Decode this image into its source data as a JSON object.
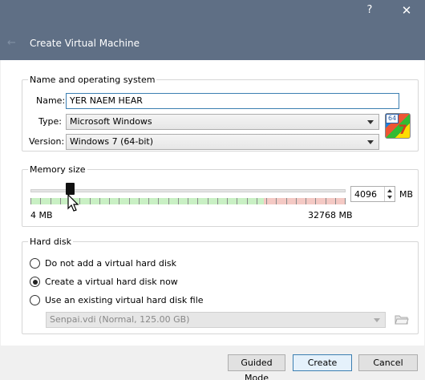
{
  "window": {
    "title": "Create Virtual Machine",
    "help_glyph": "?",
    "close_glyph": "✕",
    "back_glyph": "←"
  },
  "name_os": {
    "legend": "Name and operating system",
    "name_label": "Name:",
    "name_value": "YER NAEM HEAR",
    "type_label": "Type:",
    "type_value": "Microsoft Windows",
    "version_label": "Version:",
    "version_value": "Windows 7 (64-bit)",
    "os_icon": "windows-7-64bit-icon",
    "os_icon_badge": "64",
    "os_icon_version": "7"
  },
  "memory": {
    "legend": "Memory size",
    "min_label": "4 MB",
    "max_label": "32768 MB",
    "value": "4096",
    "unit": "MB",
    "slider_fraction": 0.125,
    "green_fraction": 0.74
  },
  "hard_disk": {
    "legend": "Hard disk",
    "options": [
      {
        "label": "Do not add a virtual hard disk",
        "checked": false
      },
      {
        "label": "Create a virtual hard disk now",
        "checked": true
      },
      {
        "label": "Use an existing virtual hard disk file",
        "checked": false
      }
    ],
    "existing_file": "Senpai.vdi (Normal, 125.00 GB)"
  },
  "buttons": {
    "guided": "Guided Mode",
    "create": "Create",
    "cancel": "Cancel"
  }
}
